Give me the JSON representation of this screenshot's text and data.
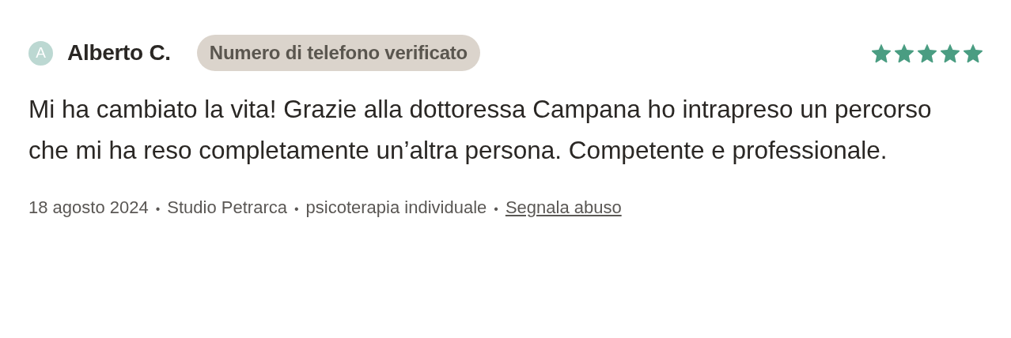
{
  "review": {
    "avatar": {
      "letter": "A"
    },
    "author": "Alberto C.",
    "badge": "Numero di telefono verificato",
    "stars": 5,
    "text": "Mi ha cambiato la vita! Grazie alla dottoressa Campana ho intrapreso un percorso che mi ha reso completamente un’altra persona. Competente e professionale.",
    "meta": [
      {
        "kind": "text",
        "text": "18 agosto 2024"
      },
      {
        "kind": "separator",
        "text": "•"
      },
      {
        "kind": "text",
        "text": "Studio Petrarca"
      },
      {
        "kind": "separator",
        "text": "•"
      },
      {
        "kind": "text",
        "text": "psicoterapia individuale"
      },
      {
        "kind": "separator",
        "text": "•"
      },
      {
        "kind": "link",
        "text": "Segnala abuso"
      }
    ]
  }
}
